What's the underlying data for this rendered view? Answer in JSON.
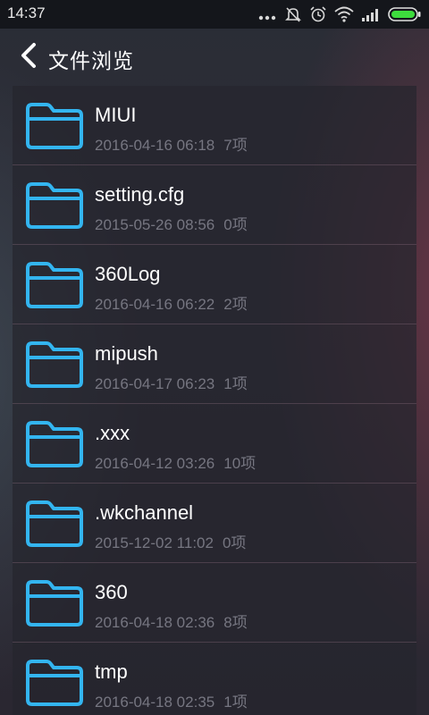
{
  "status_bar": {
    "time": "14:37",
    "icons": [
      "more-icon",
      "mute-icon",
      "alarm-icon",
      "wifi-icon",
      "signal-icon",
      "battery-icon"
    ],
    "battery_color": "#3ddc3d"
  },
  "header": {
    "back_icon": "chevron-left-icon",
    "title": "文件浏览"
  },
  "accent_color": "#33b5f0",
  "files": [
    {
      "name": "MIUI",
      "date": "2016-04-16 06:18",
      "count": "7项"
    },
    {
      "name": "setting.cfg",
      "date": "2015-05-26 08:56",
      "count": "0项"
    },
    {
      "name": "360Log",
      "date": "2016-04-16 06:22",
      "count": "2项"
    },
    {
      "name": "mipush",
      "date": "2016-04-17 06:23",
      "count": "1项"
    },
    {
      "name": ".xxx",
      "date": "2016-04-12 03:26",
      "count": "10项"
    },
    {
      "name": ".wkchannel",
      "date": "2015-12-02 11:02",
      "count": "0项"
    },
    {
      "name": "360",
      "date": "2016-04-18 02:36",
      "count": "8项"
    },
    {
      "name": "tmp",
      "date": "2016-04-18 02:35",
      "count": "1项"
    }
  ]
}
